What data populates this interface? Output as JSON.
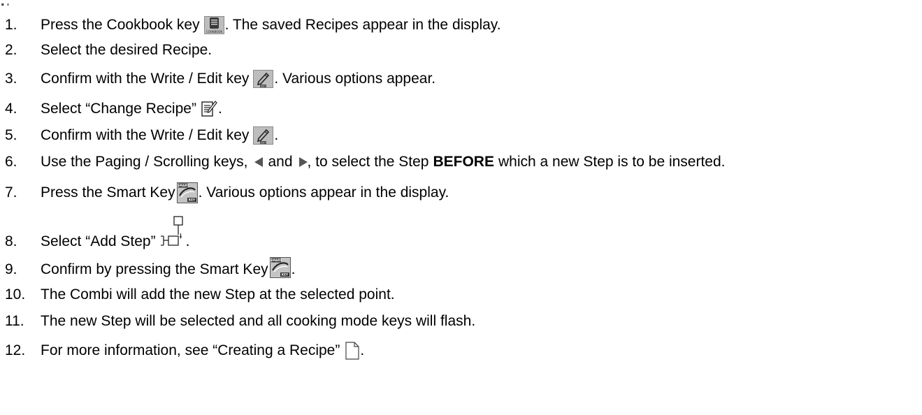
{
  "steps": [
    {
      "number": "1.",
      "before": "Press the Cookbook key",
      "icon": "cookbook-key-icon",
      "after": ". The saved Recipes appear in the display."
    },
    {
      "number": "2.",
      "text": "Select the desired Recipe."
    },
    {
      "number": "3.",
      "before": "Confirm with the Write / Edit key",
      "icon": "write-edit-key-icon",
      "after": ". Various options appear."
    },
    {
      "number": "4.",
      "before": "Select “Change Recipe”",
      "icon": "change-recipe-icon",
      "after": "."
    },
    {
      "number": "5.",
      "before": "Confirm with the Write / Edit key",
      "icon": "write-edit-key-icon",
      "after": "."
    },
    {
      "number": "6.",
      "part1": "Use the Paging / Scrolling keys,",
      "left_icon": "paging-left-icon",
      "and": "and",
      "right_icon": "paging-right-icon",
      "part2": ", to select the Step",
      "bold": "BEFORE",
      "part3": "which a new Step is to be inserted."
    },
    {
      "number": "7.",
      "before": "Press the Smart Key",
      "icon": "smart-key-icon",
      "after": ". Various options appear in the display."
    },
    {
      "number": "8.",
      "before": "Select “Add Step”",
      "icon": "add-step-icon",
      "after": "."
    },
    {
      "number": "9.",
      "before": "Confirm by pressing the Smart Key",
      "icon": "smart-key-icon",
      "after": "."
    },
    {
      "number": "10.",
      "text": "The Combi will add the new Step at the selected point."
    },
    {
      "number": "11.",
      "text": "The new Step will be selected and all cooking mode keys will flash."
    },
    {
      "number": "12.",
      "before": "For more information, see “Creating a Recipe”",
      "icon": "new-recipe-document-icon",
      "after": "."
    }
  ],
  "icons": {
    "cookbook_label": "COOKBOOK",
    "edit_label": "EDIT",
    "smart_top_label": "SMART",
    "smart_bottom_label": "KEY"
  },
  "colors": {
    "text": "#000000",
    "key_gray": "#b5b5b5",
    "key_dark": "#3a3a3a"
  }
}
